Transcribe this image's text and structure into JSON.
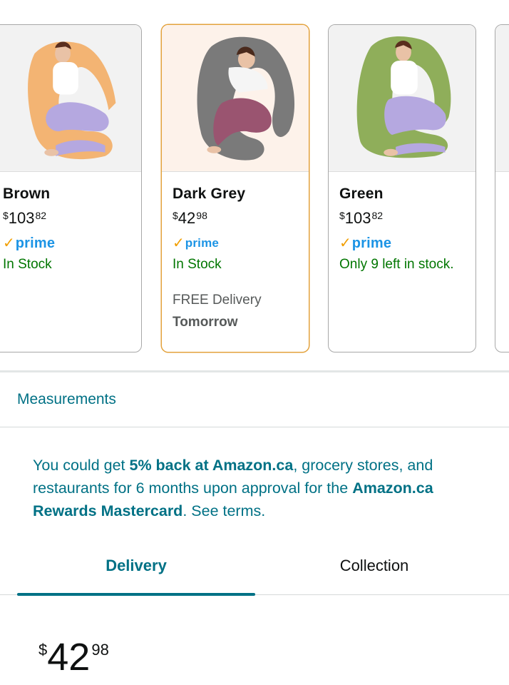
{
  "variants": [
    {
      "color": "Brown",
      "price_symbol": "$",
      "price_whole": "103",
      "price_fraction": "82",
      "prime_label": "prime",
      "stock": "In Stock",
      "pillow_color": "#f3b473",
      "selected": false
    },
    {
      "color": "Dark Grey",
      "price_symbol": "$",
      "price_whole": "42",
      "price_fraction": "98",
      "prime_label": "prime",
      "stock": "In Stock",
      "delivery": "FREE Delivery",
      "delivery_day": "Tomorrow",
      "pillow_color": "#7a7a7a",
      "selected": true
    },
    {
      "color": "Green",
      "price_symbol": "$",
      "price_whole": "103",
      "price_fraction": "82",
      "prime_label": "prime",
      "stock": "Only 9 left in stock.",
      "pillow_color": "#8fae5a",
      "selected": false
    }
  ],
  "measurements_label": "Measurements",
  "promo": {
    "part1": "You could get ",
    "bold1": "5% back at Amazon.ca",
    "part2": ", grocery stores, and restaurants for 6 months upon approval for the ",
    "bold2": "Amazon.ca Rewards Mastercard",
    "part3": ". See terms."
  },
  "tabs": {
    "delivery": "Delivery",
    "collection": "Collection",
    "active": "Delivery"
  },
  "price": {
    "symbol": "$",
    "whole": "42",
    "fraction": "98"
  },
  "colors": {
    "link": "#007185",
    "in_stock": "#007600",
    "prime_blue": "#1c94e5",
    "prime_check": "#f19e00",
    "selected_border": "#e3a23c"
  }
}
